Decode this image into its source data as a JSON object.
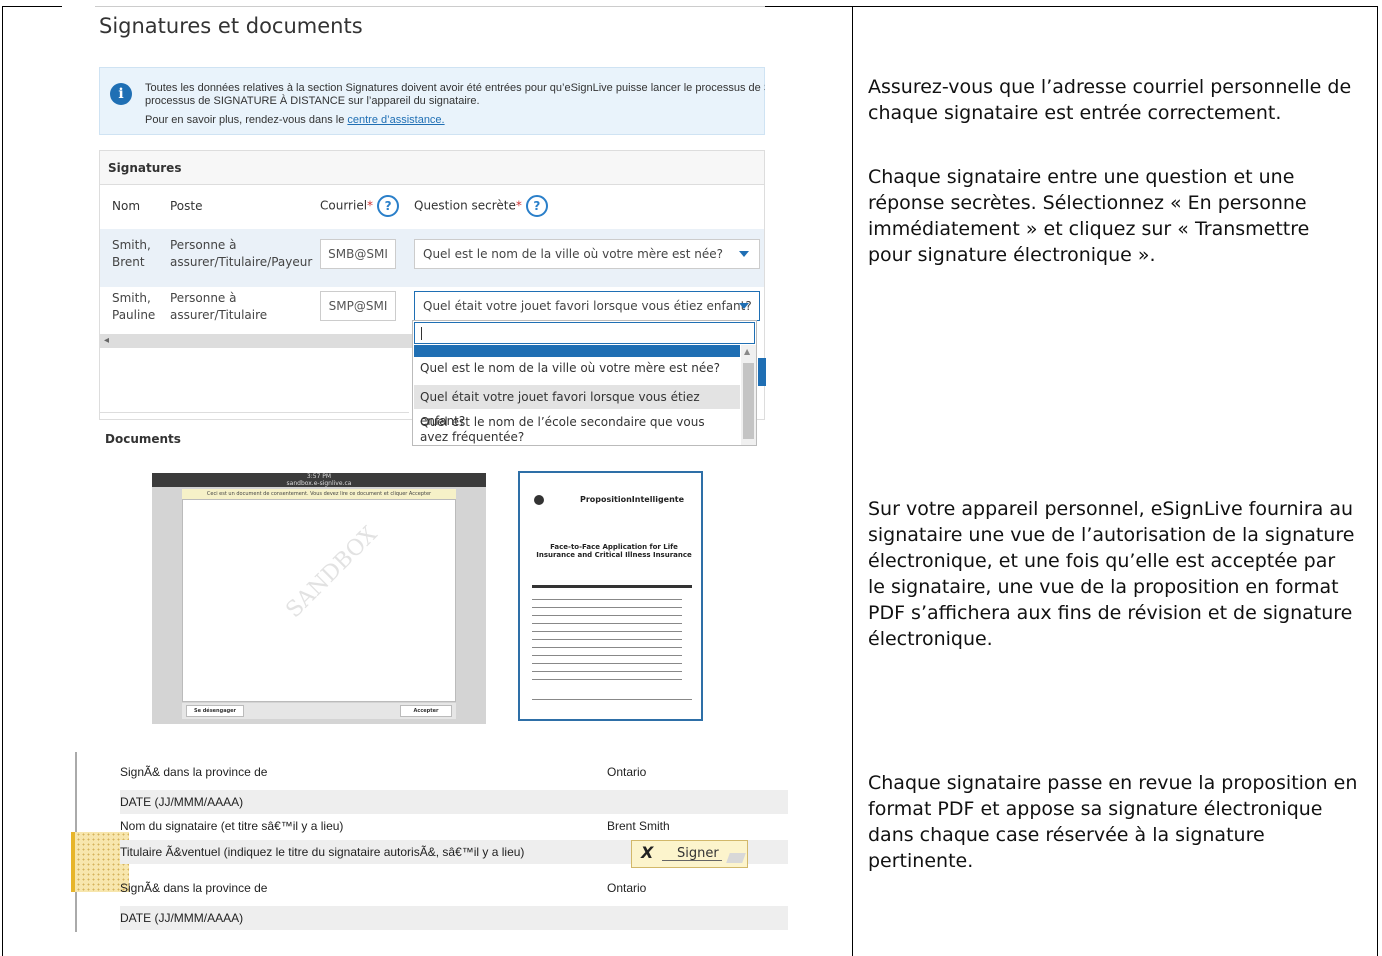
{
  "notes": [
    "Assurez-vous que l’adresse courriel personnelle de chaque signataire est entrée correctement.",
    "Chaque signataire entre une question et une réponse secrètes. Sélectionnez « En personne immédiatement » et cliquez sur « Transmettre pour signature électronique ».",
    "Sur votre appareil personnel, eSignLive fournira au signataire une vue de l’autorisation de la signature électronique, et une fois qu’elle est acceptée par le signataire, une vue de la proposition en format PDF s’affichera aux fins de révision et de signature électronique.",
    "Chaque signataire passe en revue la proposition en format PDF et appose sa signature électronique dans chaque case réservée à la signature pertinente."
  ],
  "shot1": {
    "title": "Signatures et documents",
    "info_line1": "Toutes les données relatives à la section Signatures doivent avoir été entrées pour qu’eSignLive puisse lancer le processus de SIGN",
    "info_line2": "processus de SIGNATURE À DISTANCE sur l’appareil du signataire.",
    "info_line3_prefix": "Pour en savoir plus, rendez-vous dans le ",
    "info_link": "centre d’assistance.",
    "panel_title": "Signatures",
    "columns": {
      "nom": "Nom",
      "poste": "Poste",
      "courriel": "Courriel",
      "question": "Question secrète",
      "required_mark": "*",
      "help": "?"
    },
    "rows": [
      {
        "nom1": "Smith,",
        "nom2": "Brent",
        "poste1": "Personne à",
        "poste2": "assurer/Titulaire/Payeur",
        "email": "SMB@SMI",
        "question": "Quel est le nom de la ville où votre mère est née?"
      },
      {
        "nom1": "Smith,",
        "nom2": "Pauline",
        "poste1": "Personne à",
        "poste2": "assurer/Titulaire",
        "email": "SMP@SMI",
        "question": "Quel était votre jouet favori lorsque vous étiez enfant?"
      }
    ],
    "dropdown_options": [
      "Quel est le nom de la ville où votre mère est née?",
      "Quel était votre jouet favori lorsque vous étiez enfant?",
      "Quel est le nom de l’école secondaire que vous avez fréquentée?"
    ],
    "docs_label": "Documents"
  },
  "tablet": {
    "status": "3:57 PM",
    "url": "sandbox.e-signlive.ca",
    "banner": "Ceci est un document de consentement. Vous devez lire ce document et cliquer Accepter",
    "watermark": "SANDBOX",
    "btn_decline": "Se désengager",
    "btn_accept": "Accepter"
  },
  "pdf": {
    "brand": "PropositionIntelligente",
    "title": "Face-to-Face Application for Life Insurance and Critical Illness Insurance"
  },
  "sign": {
    "rows": [
      {
        "label": "SignÃ& dans la province de",
        "value": "Ontario"
      },
      {
        "label": "DATE (JJ/MMM/AAAA)",
        "value": ""
      },
      {
        "label": "Nom du signataire (et titre sâ€™il y a lieu)",
        "value": "Brent Smith"
      },
      {
        "label": "Titulaire Ã&ventuel (indiquez le titre du signataire autorisÃ&, sâ€™il y a lieu)",
        "value": ""
      },
      {
        "label": "SignÃ& dans la province de",
        "value": "Ontario"
      },
      {
        "label": "DATE (JJ/MMM/AAAA)",
        "value": ""
      }
    ],
    "signer_x": "X",
    "signer_label": "Signer"
  }
}
